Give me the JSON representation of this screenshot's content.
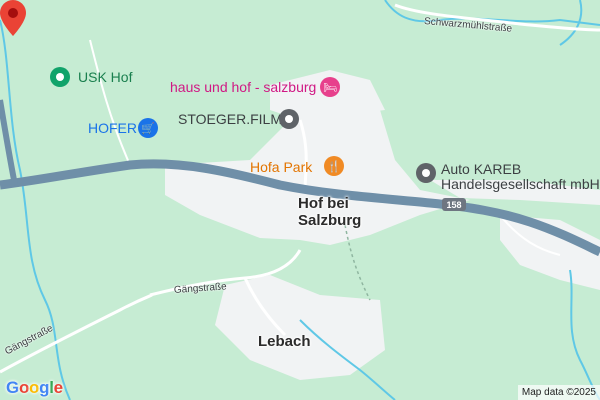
{
  "map": {
    "colors": {
      "forest": "#c6ecd3",
      "urban": "#f1f3f4",
      "road_main": "#6f8fa8",
      "water": "#5fc8e6",
      "poi_green": "#11a36a",
      "poi_blue": "#1a73e8",
      "poi_pink": "#e7408c",
      "poi_grey": "#5f6368",
      "poi_orange": "#f08a24",
      "marker_red": "#ea4335"
    },
    "pois": [
      {
        "label": "USK Hof",
        "icon": "sports-icon",
        "color": "#1a7f4e"
      },
      {
        "label": "HOFER",
        "icon": "shopping-cart-icon",
        "color": "#1a73e8"
      },
      {
        "label": "haus und hof - salzburg",
        "icon": "hotel-bed-icon",
        "color": "#d01884"
      },
      {
        "label": "STOEGER.FILM",
        "icon": "place-icon",
        "color": "#3c4043"
      },
      {
        "label": "Hofa Park",
        "icon": "restaurant-icon",
        "color": "#e37400"
      },
      {
        "label": "Auto KAREB",
        "label2": "Handelsgesellschaft mbH",
        "icon": "place-icon",
        "color": "#3c4043"
      }
    ],
    "places": [
      {
        "label": "Hof bei",
        "label2": "Salzburg"
      },
      {
        "label": "Lebach"
      }
    ],
    "streets": [
      {
        "label": "Schwarzmühlstraße"
      },
      {
        "label": "Gängstraße"
      },
      {
        "label": "Gängstraße"
      }
    ],
    "route_shield": "158",
    "marker_icon": "location-pin-icon",
    "logo": "Google",
    "attribution": "Map data ©2025"
  }
}
